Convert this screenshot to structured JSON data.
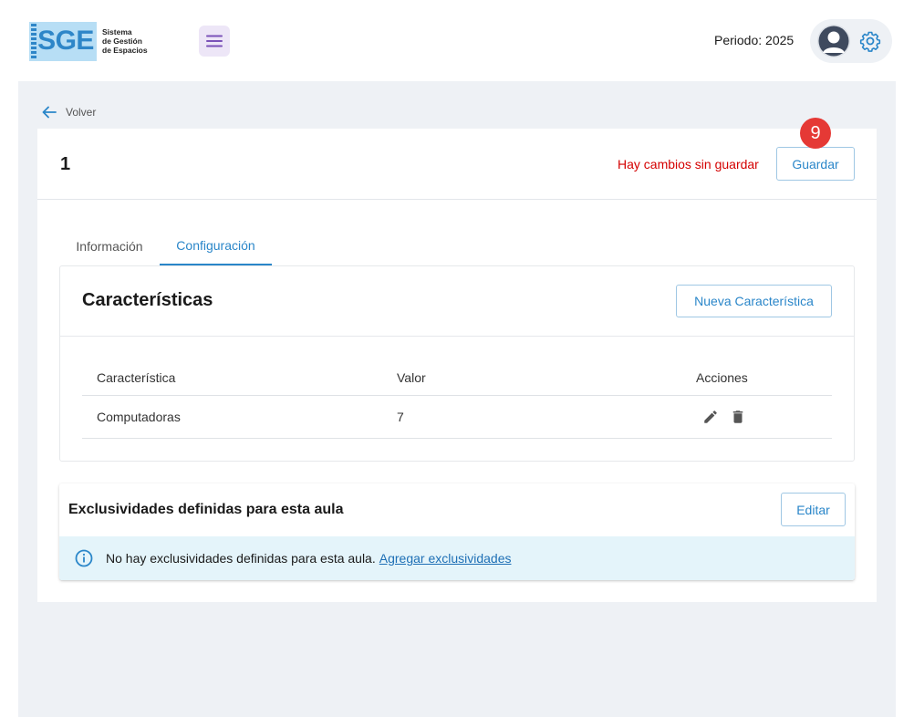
{
  "header": {
    "logo_letters": "SGE",
    "logo_lines": [
      "Sistema",
      "de Gestión",
      "de Espacios"
    ],
    "periodo": "Periodo: 2025"
  },
  "back_label": "Volver",
  "card": {
    "title": "1",
    "unsaved_message": "Hay cambios sin guardar",
    "save_label": "Guardar",
    "badge_count": "9"
  },
  "tabs": [
    {
      "label": "Información",
      "active": false
    },
    {
      "label": "Configuración",
      "active": true
    }
  ],
  "caracteristicas": {
    "title": "Características",
    "new_label": "Nueva Característica",
    "columns": [
      "Característica",
      "Valor",
      "Acciones"
    ],
    "rows": [
      {
        "caracteristica": "Computadoras",
        "valor": "7"
      }
    ]
  },
  "exclusividades": {
    "title": "Exclusividades definidas para esta aula",
    "edit_label": "Editar",
    "empty_message": "No hay exclusividades definidas para esta aula.",
    "add_link": "Agregar exclusividades"
  },
  "colors": {
    "accent": "#2a86c9",
    "unsaved": "#d40000",
    "badge": "#e53935",
    "menu_bg": "#ede6f7",
    "info_bg": "#e4f4fa",
    "page_bg": "#eef1f5"
  },
  "icons": [
    "menu-icon",
    "avatar-icon",
    "gear-icon",
    "arrow-left-icon",
    "pencil-icon",
    "trash-icon",
    "info-icon"
  ]
}
